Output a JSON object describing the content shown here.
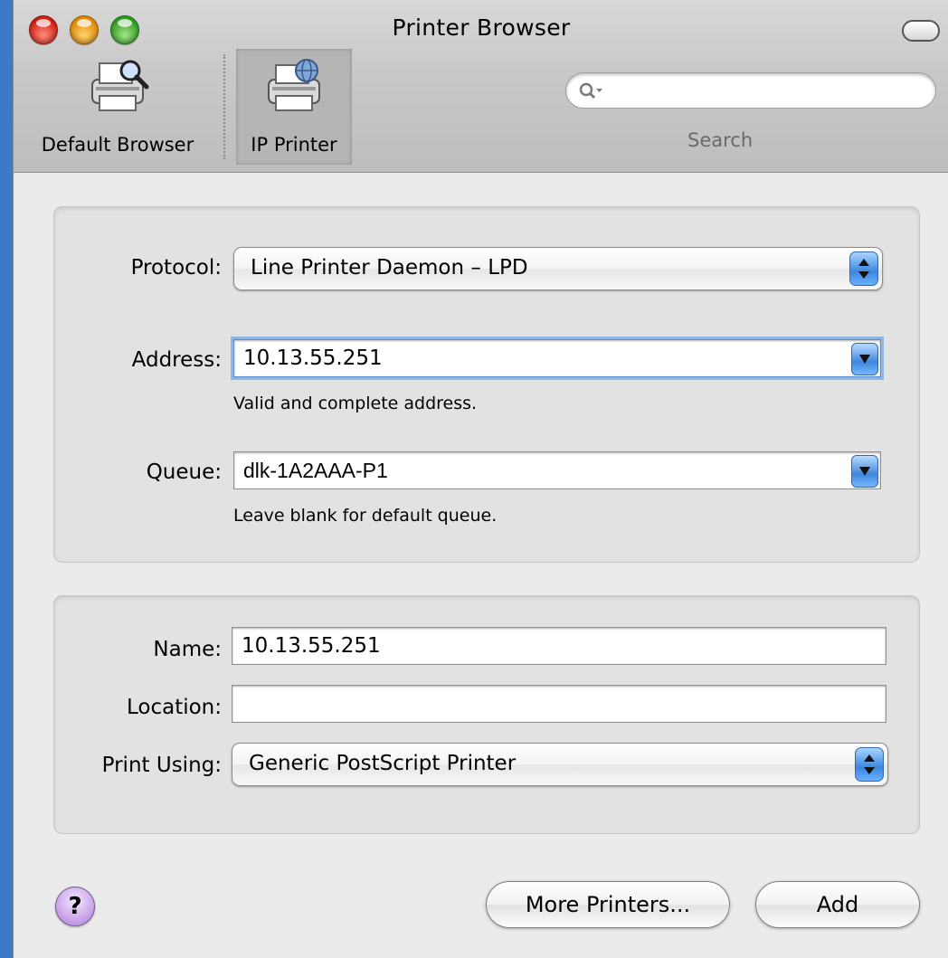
{
  "window": {
    "title": "Printer Browser"
  },
  "toolbar": {
    "items": [
      {
        "label": "Default Browser",
        "icon": "printer-magnifier-icon"
      },
      {
        "label": "IP Printer",
        "icon": "printer-globe-icon",
        "selected": true
      }
    ],
    "search": {
      "label": "Search",
      "value": "",
      "placeholder": ""
    }
  },
  "connection": {
    "protocol_label": "Protocol:",
    "protocol_value": "Line Printer Daemon – LPD",
    "address_label": "Address:",
    "address_value": "10.13.55.251",
    "address_hint": "Valid and complete address.",
    "queue_label": "Queue:",
    "queue_value": "dlk-1A2AAA-P1",
    "queue_hint": "Leave blank for default queue."
  },
  "details": {
    "name_label": "Name:",
    "name_value": "10.13.55.251",
    "location_label": "Location:",
    "location_value": "",
    "print_using_label": "Print Using:",
    "print_using_value": "Generic PostScript Printer"
  },
  "footer": {
    "help_label": "?",
    "more_printers_label": "More Printers...",
    "add_label": "Add"
  },
  "colors": {
    "accent_blue": "#3a86e0",
    "desktop": "#3e78c8"
  }
}
